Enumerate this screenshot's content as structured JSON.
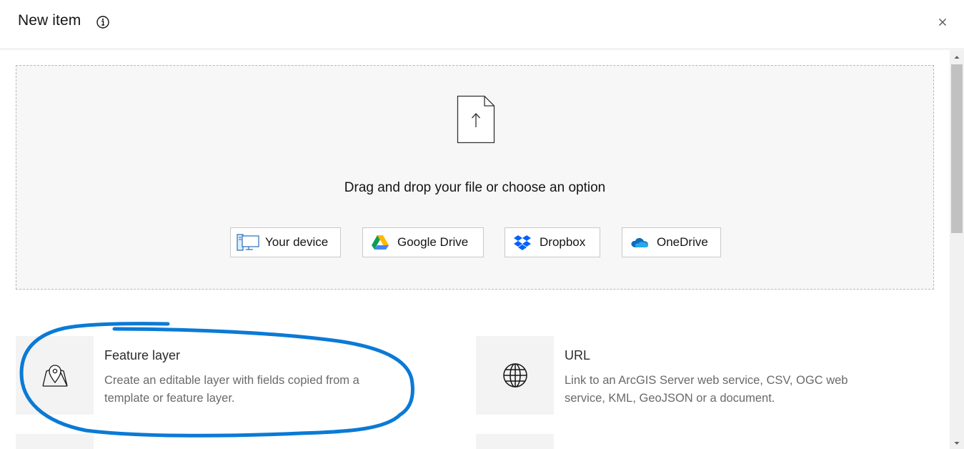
{
  "header": {
    "title": "New item",
    "info_icon": "info-icon",
    "close_icon": "close-icon"
  },
  "dropzone": {
    "upload_icon": "file-upload-icon",
    "prompt": "Drag and drop your file or choose an option",
    "sources": [
      {
        "label": "Your device",
        "icon": "device-icon"
      },
      {
        "label": "Google Drive",
        "icon": "google-drive-icon"
      },
      {
        "label": "Dropbox",
        "icon": "dropbox-icon"
      },
      {
        "label": "OneDrive",
        "icon": "onedrive-icon"
      }
    ]
  },
  "item_types": [
    {
      "title": "Feature layer",
      "description": "Create an editable layer with fields copied from a template or feature layer.",
      "icon": "map-pin-layer-icon"
    },
    {
      "title": "URL",
      "description": "Link to an ArcGIS Server web service, CSV, OGC web service, KML, GeoJSON or a document.",
      "icon": "globe-icon"
    }
  ],
  "annotation": {
    "color": "#0a7ad6",
    "shape": "hand-drawn-ellipse-around-feature-layer"
  },
  "colors": {
    "accent_blue": "#0a7ad6",
    "border": "#c9c9c9",
    "background": "#ffffff"
  }
}
